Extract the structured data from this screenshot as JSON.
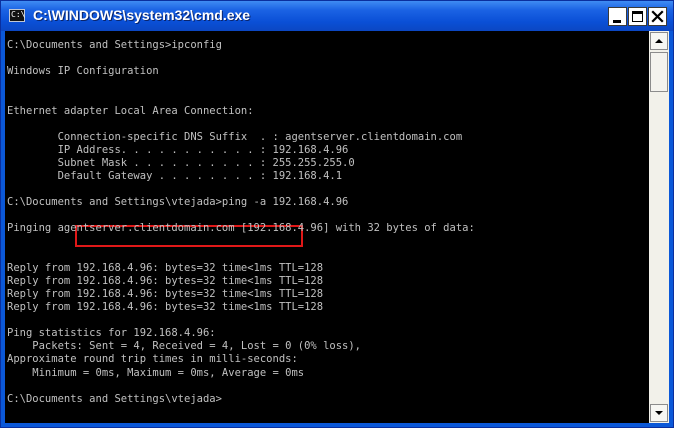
{
  "window": {
    "title": "C:\\WINDOWS\\system32\\cmd.exe",
    "icon_label": "C:\\",
    "icon_name": "console-app-icon",
    "controls": {
      "minimize": "minimize-icon",
      "maximize": "maximize-icon",
      "close": "close-icon"
    }
  },
  "console": {
    "lines": [
      "C:\\Documents and Settings>ipconfig",
      "",
      "Windows IP Configuration",
      "",
      "",
      "Ethernet adapter Local Area Connection:",
      "",
      "        Connection-specific DNS Suffix  . : agentserver.clientdomain.com",
      "        IP Address. . . . . . . . . . . : 192.168.4.96",
      "        Subnet Mask . . . . . . . . . . : 255.255.255.0",
      "        Default Gateway . . . . . . . . : 192.168.4.1",
      "",
      "C:\\Documents and Settings\\vtejada>ping -a 192.168.4.96",
      "",
      "Pinging agentserver.clientdomain.com [192.168.4.96] with 32 bytes of data:",
      "",
      "",
      "Reply from 192.168.4.96: bytes=32 time<1ms TTL=128",
      "Reply from 192.168.4.96: bytes=32 time<1ms TTL=128",
      "Reply from 192.168.4.96: bytes=32 time<1ms TTL=128",
      "Reply from 192.168.4.96: bytes=32 time<1ms TTL=128",
      "",
      "Ping statistics for 192.168.4.96:",
      "    Packets: Sent = 4, Received = 4, Lost = 0 (0% loss),",
      "Approximate round trip times in milli-seconds:",
      "    Minimum = 0ms, Maximum = 0ms, Average = 0ms",
      "",
      "C:\\Documents and Settings\\vtejada>"
    ],
    "highlighted_text": "agentserver.clientdomain.com",
    "text_color": "#c0c0c0",
    "background_color": "#000000",
    "highlight_color": "#e01818"
  },
  "scrollbar": {
    "up_icon": "scroll-up-arrow-icon",
    "down_icon": "scroll-down-arrow-icon"
  }
}
